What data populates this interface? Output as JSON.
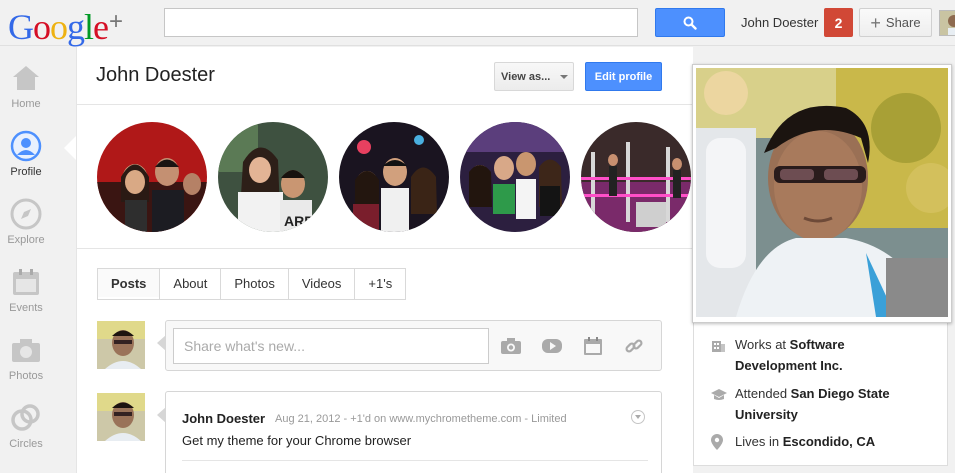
{
  "header": {
    "logo": "Google",
    "logo_plus": "+",
    "search_placeholder": "",
    "user_name": "John Doester",
    "notification_count": "2",
    "share_label": "Share"
  },
  "sidebar": {
    "items": [
      {
        "label": "Home",
        "icon": "home-icon"
      },
      {
        "label": "Profile",
        "icon": "profile-icon"
      },
      {
        "label": "Explore",
        "icon": "compass-icon"
      },
      {
        "label": "Events",
        "icon": "calendar-icon"
      },
      {
        "label": "Photos",
        "icon": "camera-icon"
      },
      {
        "label": "Circles",
        "icon": "circles-icon"
      }
    ]
  },
  "profile": {
    "name": "John Doester",
    "view_as_label": "View as...",
    "edit_label": "Edit profile",
    "tabs": [
      "Posts",
      "About",
      "Photos",
      "Videos",
      "+1's"
    ]
  },
  "composer": {
    "placeholder": "Share what's new..."
  },
  "post": {
    "author": "John Doester",
    "meta": "Aug 21, 2012  -  +1'd on www.mychrometheme.com  -  Limited",
    "text": "Get my theme for your Chrome browser"
  },
  "about": {
    "works_prefix": "Works at ",
    "works_value": "Software Development Inc.",
    "attended_prefix": "Attended ",
    "attended_value": "San Diego State University",
    "lives_prefix": "Lives in ",
    "lives_value": "Escondido, CA"
  },
  "colors": {
    "accent_blue": "#4d90fe",
    "notification_red": "#d14836",
    "sidebar_active": "#4d90fe"
  }
}
